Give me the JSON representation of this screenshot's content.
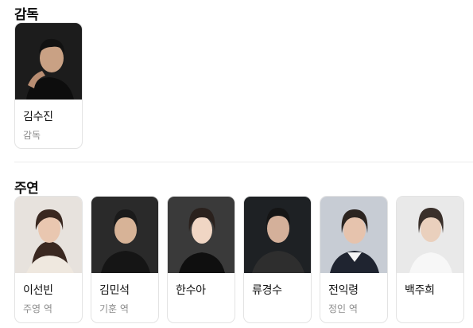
{
  "sections": {
    "director_title": "감독",
    "cast_title": "주연"
  },
  "director": {
    "name": "김수진",
    "role": "감독"
  },
  "cast": [
    {
      "name": "이선빈",
      "role": "주영 역"
    },
    {
      "name": "김민석",
      "role": "기훈 역"
    },
    {
      "name": "한수아",
      "role": ""
    },
    {
      "name": "류경수",
      "role": ""
    },
    {
      "name": "전익령",
      "role": "정인 역"
    },
    {
      "name": "백주희",
      "role": ""
    }
  ]
}
